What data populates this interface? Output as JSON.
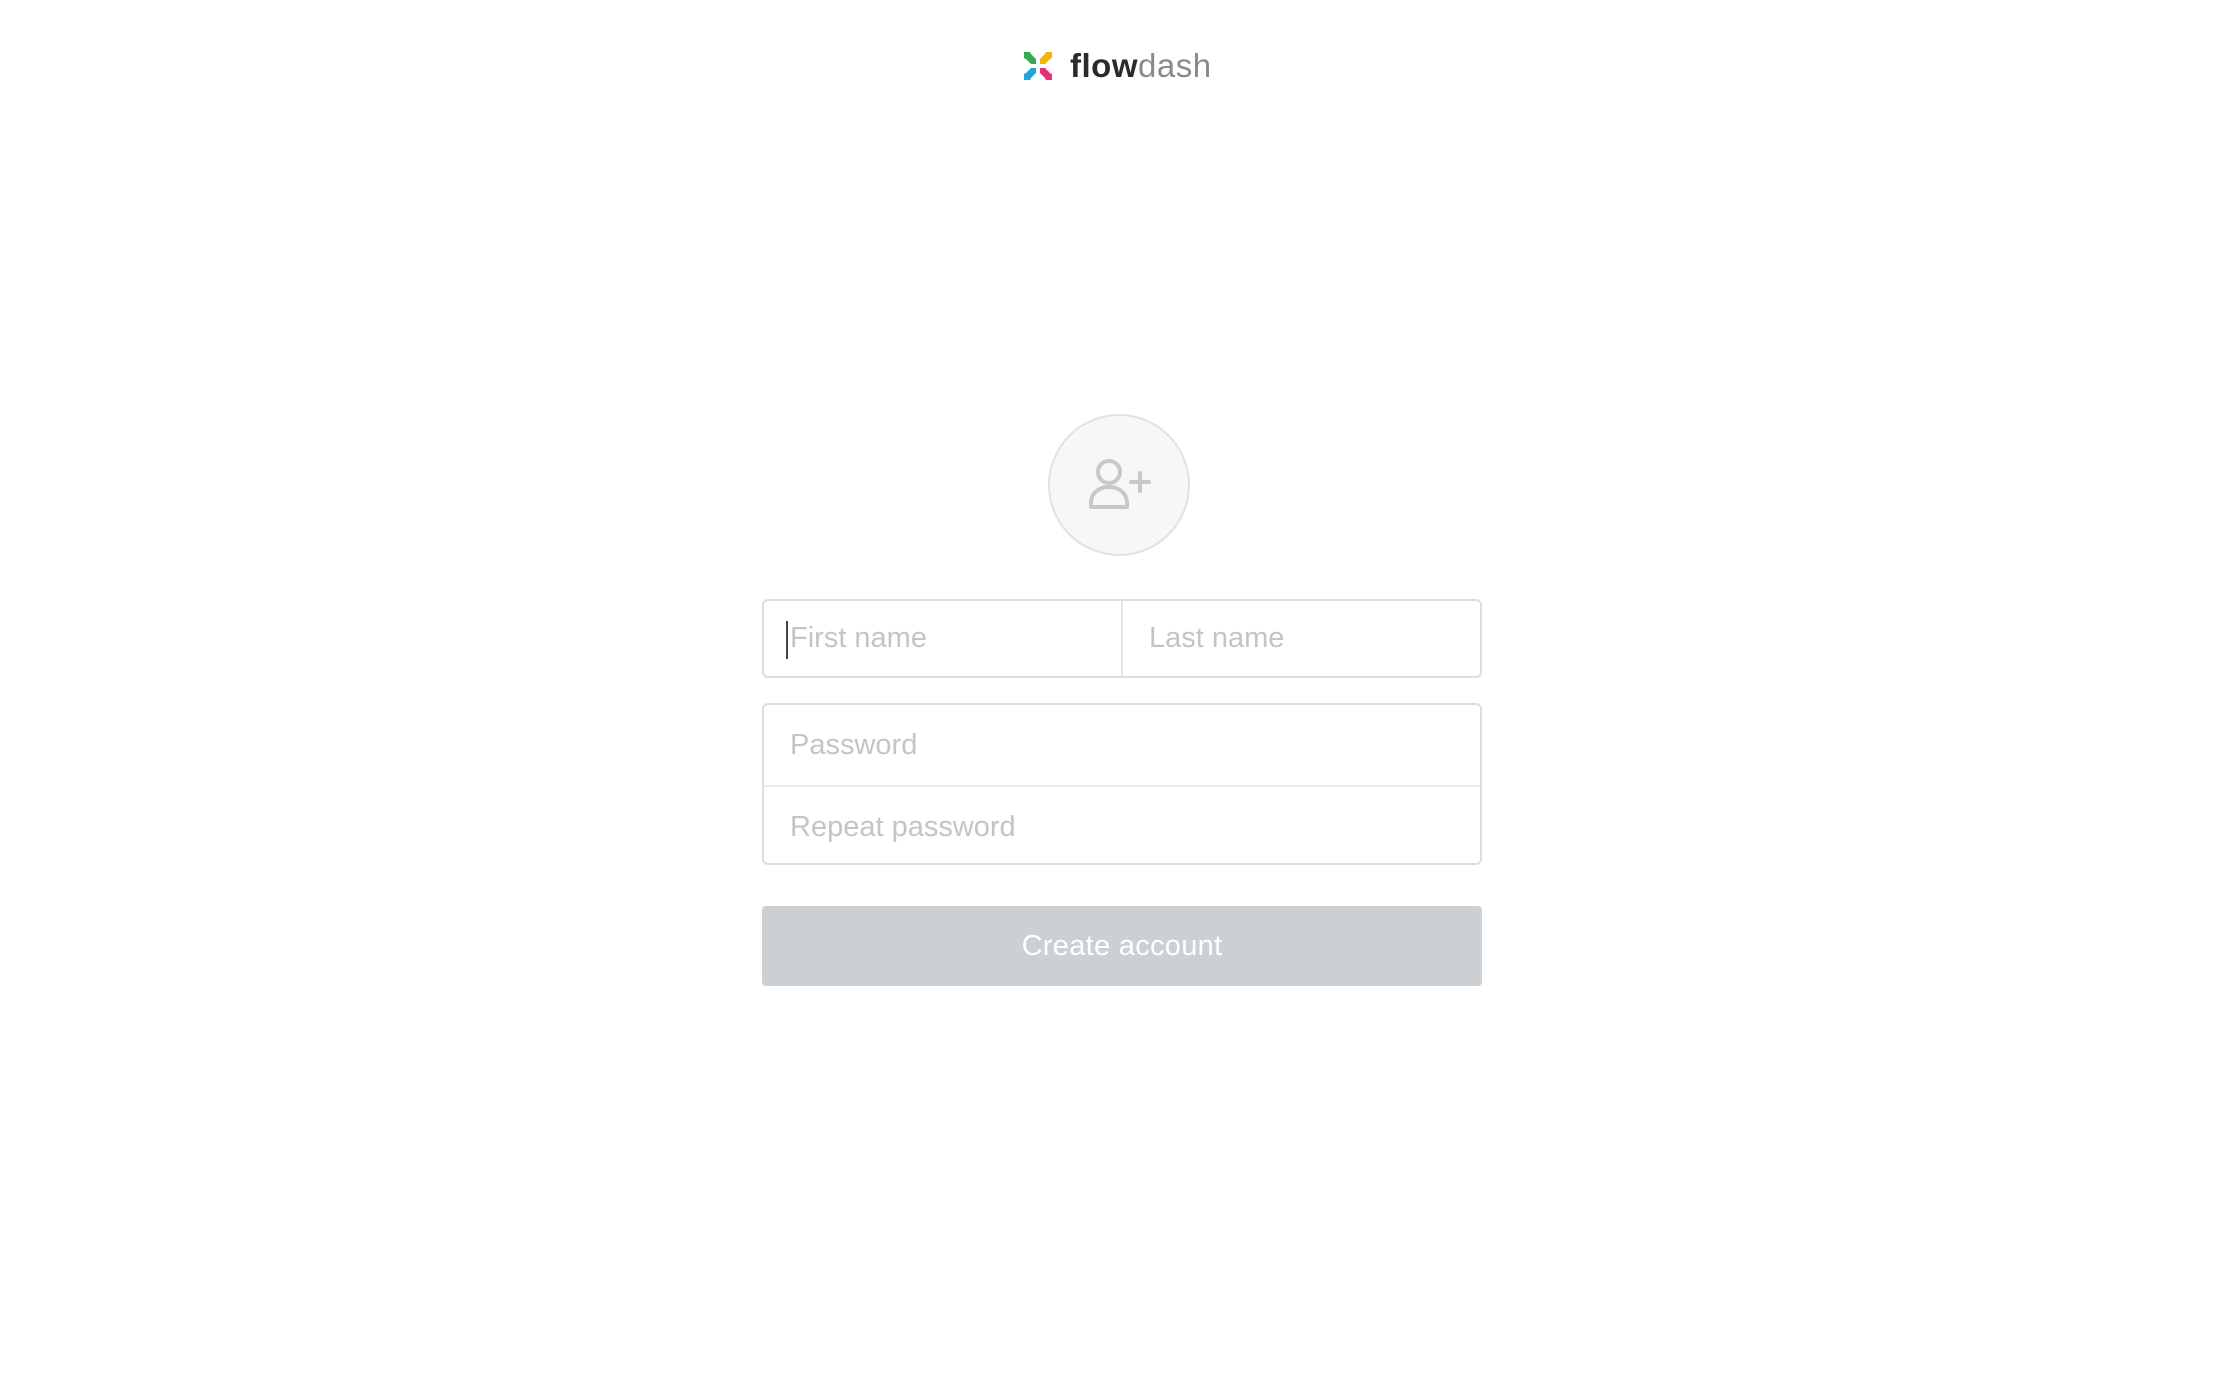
{
  "brand": {
    "name_bold": "flow",
    "name_light": "dash",
    "colors": {
      "green": "#34a853",
      "yellow": "#f5b400",
      "blue": "#1ea7d6",
      "pink": "#e8307a"
    }
  },
  "avatar": {
    "icon": "user-plus-icon"
  },
  "form": {
    "first_name": {
      "placeholder": "First name",
      "value": ""
    },
    "last_name": {
      "placeholder": "Last name",
      "value": ""
    },
    "password": {
      "placeholder": "Password",
      "value": ""
    },
    "repeat_password": {
      "placeholder": "Repeat password",
      "value": ""
    },
    "submit_label": "Create account",
    "submit_bg": "#cdd0d3"
  }
}
